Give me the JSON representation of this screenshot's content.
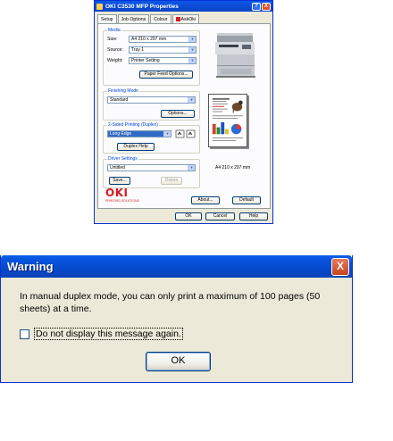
{
  "props_window": {
    "title": "OKI C3530 MFP Properties",
    "help_glyph": "?",
    "close_glyph": "X",
    "tabs": [
      "Setup",
      "Job Options",
      "Colour",
      "AskOki"
    ],
    "media_group": "Media",
    "size_label": "Size:",
    "size_value": "A4 210 x 297 mm",
    "source_label": "Source:",
    "source_value": "Tray 1",
    "weight_label": "Weight:",
    "weight_value": "Printer Setting",
    "paper_feed_button": "Paper Feed Options...",
    "finishing_group": "Finishing Mode",
    "finishing_value": "Standard",
    "options_button": "Options...",
    "duplex_group": "2-Sided Printing (Duplex)",
    "duplex_value": "Long Edge",
    "duplex_help_button": "Duplex Help",
    "driver_group": "Driver Settings",
    "driver_value": "Untitled",
    "save_button": "Save...",
    "delete_button": "Delete",
    "paper_label": "A4 210 x 297 mm",
    "logo_text": "OKI",
    "logo_tagline": "PRINTING SOLUTIONS",
    "about_button": "About...",
    "default_button": "Default",
    "ok_button": "OK",
    "cancel_button": "Cancel",
    "help_button": "Help"
  },
  "warning_dialog": {
    "title": "Warning",
    "close_glyph": "X",
    "message": "In manual duplex mode, you can only print a maximum of 100 pages (50 sheets) at a time.",
    "checkbox_label": "Do not display this message again.",
    "checkbox_checked": false,
    "ok_button": "OK"
  },
  "colors": {
    "title_blue": "#0a58e6",
    "close_red": "#e0532a",
    "oki_red": "#d71920",
    "dialog_bg": "#ece9d8"
  }
}
